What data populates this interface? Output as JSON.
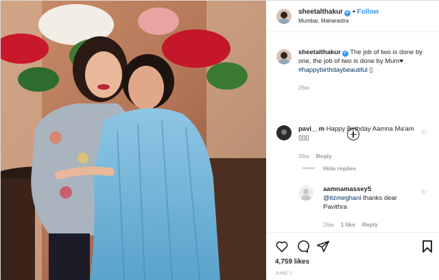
{
  "header": {
    "username": "sheetalthakur",
    "follow_label": "Follow",
    "location": "Mumbai, Maharastra",
    "dot": "•",
    "verified_mark": "✔"
  },
  "caption": {
    "username": "sheetalthakur",
    "text": "The job of two is done by one, the job of two is done by Mum♥",
    "hashtag": "#happybirthdaybeautiful",
    "emoji": "▯",
    "time": "26w"
  },
  "comments": [
    {
      "username": "pavi__m",
      "text": "Happy Birthday Aamna Ma'am ▯▯▯",
      "time": "26w",
      "reply_label": "Reply",
      "hide_replies_label": "Hide replies"
    },
    {
      "username": "aamnamassey5",
      "mention": "@itzmeghani",
      "text": "thanks dear Pavithra",
      "time": "26w",
      "likes": "1 like",
      "reply_label": "Reply"
    }
  ],
  "footer": {
    "likes": "4,759 likes",
    "date": "JUNE 2"
  },
  "colors": {
    "accent": "#3897f0",
    "hashtag": "#003569",
    "muted": "#999999"
  }
}
